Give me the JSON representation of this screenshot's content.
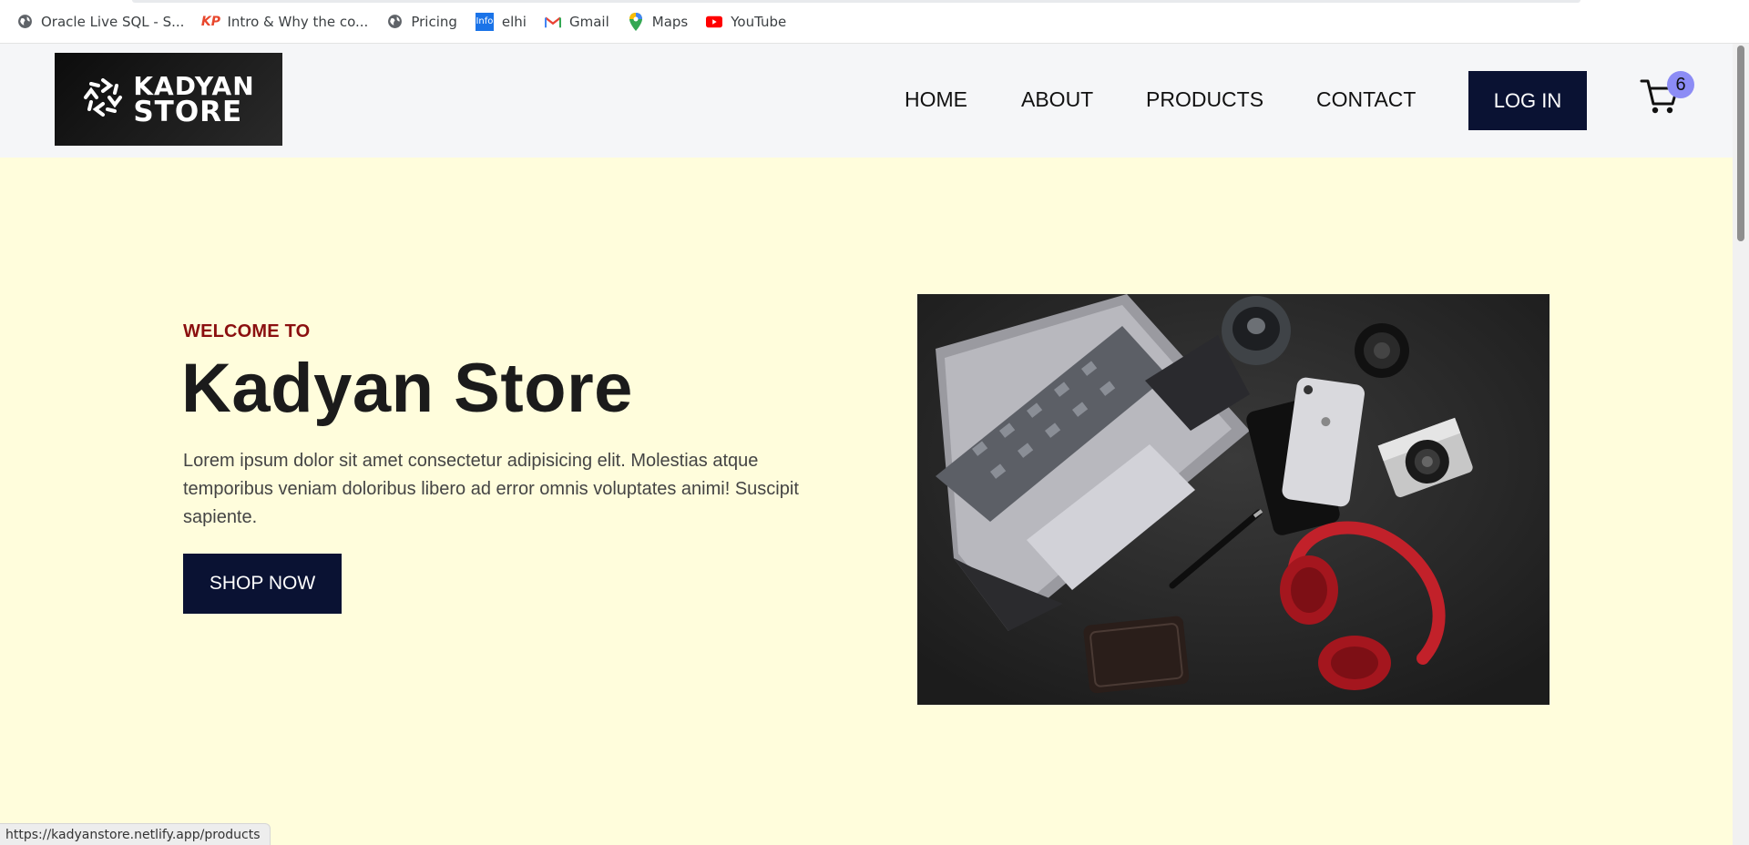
{
  "bookmarks": [
    {
      "label": "Oracle Live SQL - S...",
      "icon": "globe-icon"
    },
    {
      "label": "Intro & Why the co...",
      "icon": "kp-icon"
    },
    {
      "label": "Pricing",
      "icon": "globe-icon"
    },
    {
      "label": "elhi",
      "icon": "info-icon"
    },
    {
      "label": "Gmail",
      "icon": "gmail-icon"
    },
    {
      "label": "Maps",
      "icon": "maps-icon"
    },
    {
      "label": "YouTube",
      "icon": "youtube-icon"
    }
  ],
  "bookmark_icon_text": {
    "kp": "KP",
    "info": "Info"
  },
  "logo": {
    "line1": "KADYAN",
    "line2": "STORE"
  },
  "nav": {
    "home": "HOME",
    "about": "ABOUT",
    "products": "PRODUCTS",
    "contact": "CONTACT",
    "login": "LOG IN"
  },
  "cart": {
    "count": "6"
  },
  "hero": {
    "welcome": "WELCOME TO",
    "title": "Kadyan Store",
    "description": "Lorem ipsum dolor sit amet consectetur adipisicing elit. Molestias atque temporibus veniam doloribus libero ad error omnis voluptates animi! Suscipit sapiente.",
    "shop_button": "SHOP NOW"
  },
  "status_url": "https://kadyanstore.netlify.app/products",
  "colors": {
    "hero_bg": "#fffddc",
    "header_bg": "#f5f6f8",
    "button_bg": "#0a1233",
    "welcome": "#8b0f0f",
    "badge": "#8c8cf5"
  }
}
